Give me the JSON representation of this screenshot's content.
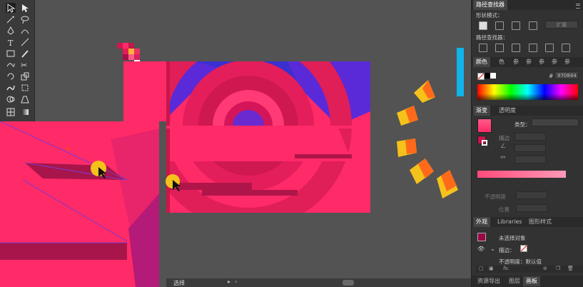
{
  "toolbar": {
    "tools": [
      "selection-tool",
      "direct-selection-tool",
      "magic-wand-tool",
      "lasso-tool",
      "pen-tool",
      "curvature-tool",
      "type-tool",
      "line-tool",
      "rectangle-tool",
      "paintbrush-tool",
      "shaper-tool",
      "scissors-tool",
      "rotate-tool",
      "scale-tool",
      "warp-tool",
      "free-transform-tool",
      "shape-builder-tool",
      "perspective-grid-tool",
      "mesh-tool",
      "gradient-tool"
    ]
  },
  "pathfinder": {
    "title": "路径查找器",
    "shape_modes_label": "形状模式：",
    "pathfinders_label": "路径查找器：",
    "expand_label": "扩展"
  },
  "color_panel": {
    "tabs": [
      "颜色",
      "色",
      "参",
      "参",
      "参",
      "参",
      "参"
    ],
    "active_tab": "颜色",
    "hex_prefix": "#",
    "hex_value": "970844"
  },
  "gradient_panel": {
    "tabs": [
      "渐变",
      "透明度"
    ],
    "active_tab": "渐变",
    "type_label": "类型：",
    "stroke_label": "描边",
    "opacity_label": "不透明度",
    "location_label": "位置"
  },
  "appearance_panel": {
    "tabs": [
      "外观",
      "Libraries",
      "图形样式"
    ],
    "active_tab": "外观",
    "no_selection": "未选择对象",
    "stroke_row": "描边：",
    "opacity_row": "不透明度：默认值",
    "fx_label": "fx."
  },
  "bottom_tabs": [
    "资源导出",
    "图层",
    "画板"
  ],
  "status": {
    "tool_name": "选择"
  },
  "colors": {
    "accent_pink": "#ff2a68",
    "deep_red": "#c8144a",
    "purple": "#5a2ad8",
    "selection_blue": "#0fb4e8",
    "yellow": "#f4c21a",
    "orange": "#ff6a1a",
    "panel_bg": "#323232"
  }
}
